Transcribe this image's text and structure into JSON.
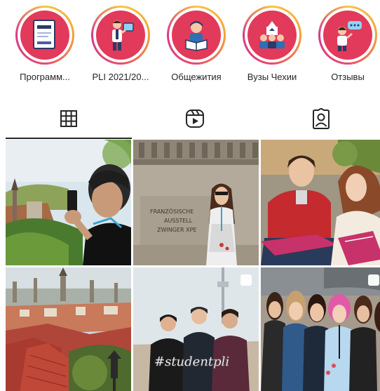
{
  "highlights": [
    {
      "label": "Программ...",
      "icon": "document-icon"
    },
    {
      "label": "PLI 2021/20...",
      "icon": "teacher-icon"
    },
    {
      "label": "Общежития",
      "icon": "student-reading-icon"
    },
    {
      "label": "Вузы Чехии",
      "icon": "university-icon"
    },
    {
      "label": "Отзывы",
      "icon": "speech-bubble-person-icon"
    }
  ],
  "tabs": [
    {
      "name": "posts",
      "icon": "grid-icon",
      "active": true
    },
    {
      "name": "reels",
      "icon": "reels-icon",
      "active": false
    },
    {
      "name": "tagged",
      "icon": "tagged-person-icon",
      "active": false
    }
  ],
  "posts": {
    "p2_sign_lines": [
      "FRANZÖSISCHE",
      "AUSSTELL",
      "ZWINGER XPE"
    ],
    "p5_sign": "#studentpli"
  },
  "colors": {
    "accent": "#e23a5a",
    "ring_start": "#f6c542",
    "ring_end": "#d43a8a",
    "text": "#262626"
  }
}
